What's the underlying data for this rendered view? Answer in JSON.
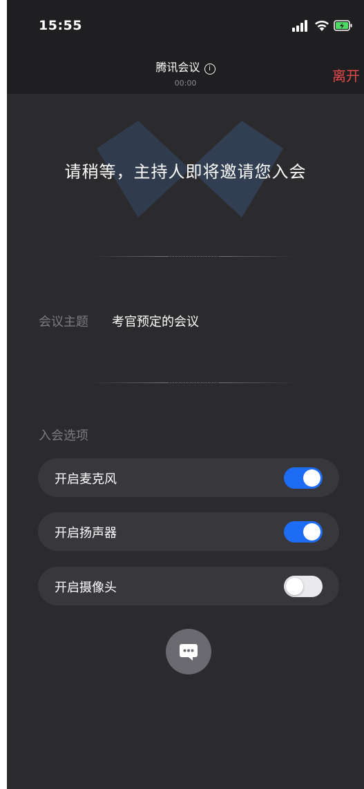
{
  "status_bar": {
    "time": "15:55"
  },
  "header": {
    "title": "腾讯会议",
    "timer": "00:00",
    "leave_label": "离开"
  },
  "waiting_message": "请稍等，主持人即将邀请您入会",
  "meeting": {
    "topic_label": "会议主题",
    "topic_value": "考官预定的会议"
  },
  "options": {
    "section_label": "入会选项",
    "items": [
      {
        "label": "开启麦克风",
        "enabled": true
      },
      {
        "label": "开启扬声器",
        "enabled": true
      },
      {
        "label": "开启摄像头",
        "enabled": false
      }
    ]
  },
  "colors": {
    "accent": "#1f6cf4",
    "leave": "#ea4a4a",
    "background": "#2b2b2e"
  },
  "icons": [
    "signal-icon",
    "wifi-icon",
    "battery-charging-icon",
    "info-icon",
    "chat-icon"
  ]
}
